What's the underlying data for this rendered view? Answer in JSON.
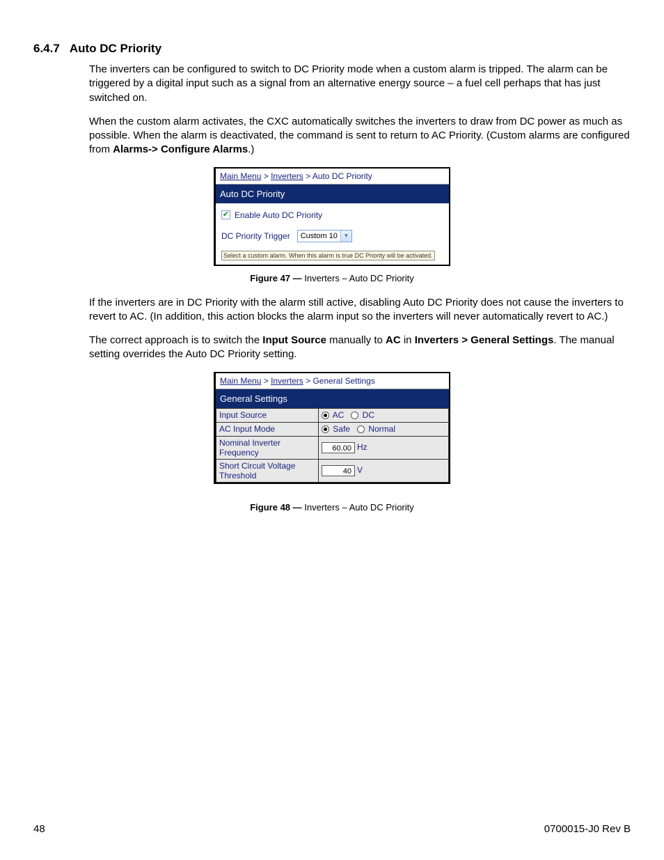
{
  "section": {
    "number": "6.4.7",
    "title": "Auto DC Priority"
  },
  "para1": "The inverters can be configured to switch to DC Priority mode when a custom alarm is tripped. The alarm can be triggered by a digital input such as a signal from an alternative energy source – a fuel cell perhaps that has just switched on.",
  "para2_a": "When the custom alarm activates, the CXC automatically switches the inverters to draw from DC power as much as possible. When the alarm is deactivated, the command is sent to return to AC Priority. (Custom alarms are configured from ",
  "para2_b": "Alarms-> Configure Alarms",
  "para2_c": ".)",
  "fig47": {
    "breadcrumb": {
      "a": "Main Menu",
      "b": "Inverters",
      "c": "Auto DC Priority",
      "sep": " > "
    },
    "header": "Auto DC Priority",
    "checkbox_label": "Enable Auto DC Priority",
    "trigger_label": "DC Priority Trigger",
    "trigger_value": "Custom 10",
    "note": "Select a custom alarm. When this alarm is true DC Priority will be activated.",
    "caption_b": "Figure 47  —  ",
    "caption_t": "Inverters – Auto DC Priority"
  },
  "para3": "If the inverters are in DC Priority with the alarm still active, disabling Auto DC Priority does not cause the inverters to revert to AC. (In addition, this action blocks the alarm input so the inverters will never automatically revert to AC.)",
  "para4_a": "The correct approach is to switch the ",
  "para4_b": "Input Source",
  "para4_c": " manually to ",
  "para4_d": "AC",
  "para4_e": " in ",
  "para4_f": "Inverters > General Settings",
  "para4_g": ". The manual setting overrides the Auto DC Priority setting.",
  "fig48": {
    "breadcrumb": {
      "a": "Main Menu",
      "b": "Inverters",
      "c": "General Settings",
      "sep": " > "
    },
    "header": "General Settings",
    "rows": {
      "input_source": {
        "label": "Input Source",
        "opt1": "AC",
        "opt2": "DC"
      },
      "ac_input_mode": {
        "label": "AC Input Mode",
        "opt1": "Safe",
        "opt2": "Normal"
      },
      "nom_freq": {
        "label": "Nominal Inverter Frequency",
        "value": "60.00",
        "unit": "Hz"
      },
      "scv": {
        "label": "Short Circuit Voltage Threshold",
        "value": "40",
        "unit": "V"
      }
    },
    "caption_b": "Figure 48  —  ",
    "caption_t": "Inverters – Auto DC Priority"
  },
  "footer": {
    "page": "48",
    "docid": "0700015-J0    Rev B"
  }
}
